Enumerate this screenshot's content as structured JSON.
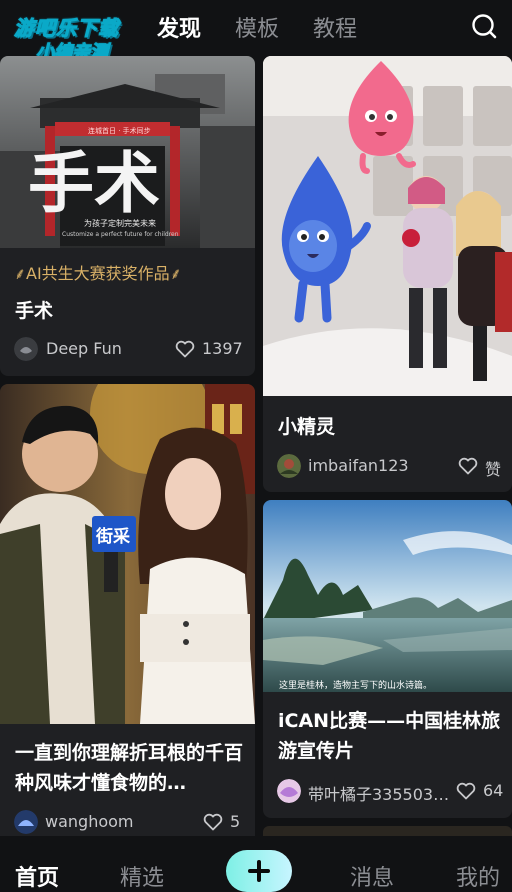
{
  "watermark": {
    "line1": "游吧乐下载",
    "line2": "小编亲测"
  },
  "top_nav": {
    "tabs": [
      "发现",
      "模板",
      "教程"
    ],
    "active": 0
  },
  "icons": {
    "search": "search-icon",
    "heart": "heart-icon",
    "plus": "plus-icon"
  },
  "cards": [
    {
      "thumb_title": "手术",
      "thumb_banner": "连城首日 · 手术同步",
      "thumb_caption_cn": "为孩子定制完美未来",
      "thumb_caption_en": "Customize a perfect future for children",
      "award": "AI共生大赛获奖作品",
      "title": "手术",
      "author": "Deep Fun",
      "likes": "1397"
    },
    {
      "title": "小精灵",
      "author": "imbaifan123",
      "likes": "赞"
    },
    {
      "thumb_badge": "街采",
      "title": "一直到你理解折耳根的千百种风味才懂食物的…",
      "author": "wanghoom",
      "likes": "5"
    },
    {
      "thumb_caption": "这里是桂林，造物主写下的山水诗篇。",
      "title": "iCAN比赛——中国桂林旅游宣传片",
      "author": "带叶橘子335503…",
      "likes": "64"
    }
  ],
  "bottom_nav": {
    "items": [
      "首页",
      "精选",
      "消息",
      "我的"
    ],
    "active": 0
  },
  "colors": {
    "background": "#111214",
    "card": "#1f2023",
    "award_gold": "#d9b167",
    "accent_teal": "#7ef0e5"
  }
}
